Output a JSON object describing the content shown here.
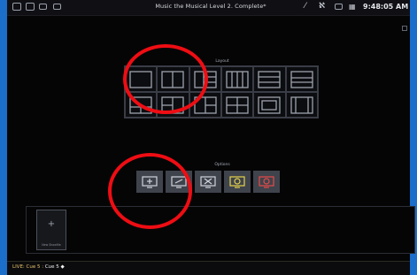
{
  "window": {
    "title": "Music the Musical Level 2. Complete*",
    "clock": "9:48:05 AM",
    "left_icons": [
      "window-icon",
      "window-icon",
      "window-icon",
      "window-icon"
    ],
    "right_icons": [
      "magic-wand-icon",
      "ma-logo-icon",
      "camera-icon",
      "grid-icon"
    ]
  },
  "layout": {
    "label": "Layout",
    "options": [
      "split-vertical",
      "split-vertical-2",
      "split-horizontal-right",
      "columns-4",
      "rows-3",
      "rows-top-split",
      "rows-bottom-split",
      "grid-left-stack",
      "grid-right-stack",
      "quad",
      "framed",
      "columns-3-center"
    ]
  },
  "options": {
    "label": "Options",
    "buttons": [
      {
        "name": "add-display-button",
        "icon": "monitor-plus-icon",
        "color": "#d0d3da"
      },
      {
        "name": "minus-display-button",
        "icon": "monitor-minus-icon",
        "color": "#d0d3da"
      },
      {
        "name": "remove-display-button",
        "icon": "monitor-x-icon",
        "color": "#d0d3da"
      },
      {
        "name": "refresh-display-button",
        "icon": "monitor-refresh-icon",
        "color": "#e6d34a"
      },
      {
        "name": "reset-display-button",
        "icon": "monitor-reset-icon",
        "color": "#e84a4a"
      }
    ]
  },
  "showfile": {
    "new_label": "New Showfile",
    "plus": "+"
  },
  "status": {
    "live": "LIVE: Cue 5 :",
    "cue": "Cue 5 ◆"
  },
  "annotations": {
    "color": "#ee0d13"
  }
}
